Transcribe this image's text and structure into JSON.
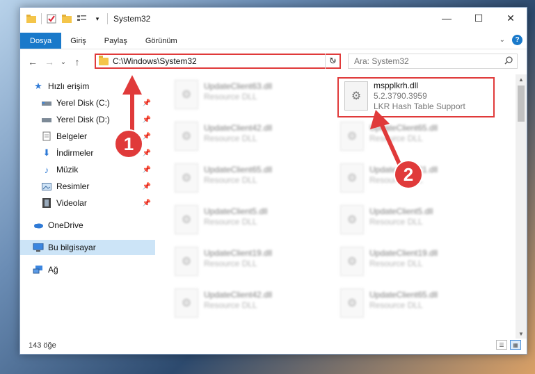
{
  "window": {
    "title": "System32",
    "controls": {
      "minimize": "—",
      "maximize": "☐",
      "close": "✕"
    }
  },
  "ribbon": {
    "tabs": [
      "Dosya",
      "Giriş",
      "Paylaş",
      "Görünüm"
    ],
    "help": "?"
  },
  "nav": {
    "back": "←",
    "forward": "→",
    "recent": "⌄",
    "up": "↑",
    "address": "C:\\Windows\\System32",
    "refresh": "↻",
    "search_placeholder": "Ara: System32"
  },
  "sidebar": {
    "items": [
      {
        "label": "Hızlı erişim",
        "icon": "star-icon"
      },
      {
        "label": "Yerel Disk (C:)",
        "icon": "drive-icon",
        "pinned": true
      },
      {
        "label": "Yerel Disk (D:)",
        "icon": "drive-icon",
        "pinned": true
      },
      {
        "label": "Belgeler",
        "icon": "document-icon",
        "pinned": true
      },
      {
        "label": "İndirmeler",
        "icon": "download-icon",
        "pinned": true
      },
      {
        "label": "Müzik",
        "icon": "music-icon",
        "pinned": true
      },
      {
        "label": "Resimler",
        "icon": "picture-icon",
        "pinned": true
      },
      {
        "label": "Videolar",
        "icon": "video-icon",
        "pinned": true
      },
      {
        "label": "OneDrive",
        "icon": "cloud-icon"
      },
      {
        "label": "Bu bilgisayar",
        "icon": "computer-icon",
        "selected": true
      },
      {
        "label": "Ağ",
        "icon": "network-icon"
      }
    ]
  },
  "files": {
    "highlighted": {
      "name": "mspplkrh.dll",
      "version": "5.2.3790.3959",
      "description": "LKR Hash Table Support"
    },
    "left_column": [
      {
        "name": "UpdateClient63.dll",
        "desc": "Resource DLL"
      },
      {
        "name": "UpdateClient42.dll",
        "desc": "Resource DLL"
      },
      {
        "name": "UpdateClient65.dll",
        "desc": "Resource DLL"
      },
      {
        "name": "UpdateClient5.dll",
        "desc": "Resource DLL"
      },
      {
        "name": "UpdateClient19.dll",
        "desc": "Resource DLL"
      },
      {
        "name": "UpdateClient42.dll",
        "desc": "Resource DLL"
      }
    ],
    "right_column": [
      {
        "name": "UpdateClient65.dll",
        "desc": "Resource DLL"
      },
      {
        "name": "UpdateClient21.dll",
        "desc": "Resource DLL"
      },
      {
        "name": "UpdateClient5.dll",
        "desc": "Resource DLL"
      },
      {
        "name": "UpdateClient19.dll",
        "desc": "Resource DLL"
      },
      {
        "name": "UpdateClient65.dll",
        "desc": "Resource DLL"
      }
    ]
  },
  "status": {
    "count": "143 öğe"
  },
  "annotations": {
    "badge1": "1",
    "badge2": "2",
    "color": "#e03a3a"
  }
}
